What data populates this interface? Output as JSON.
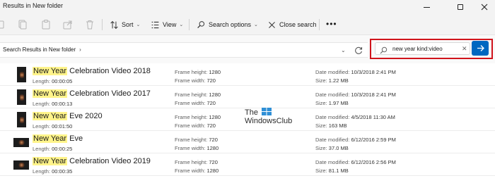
{
  "window": {
    "title": "Results in New folder"
  },
  "toolbar": {
    "sort_label": "Sort",
    "view_label": "View",
    "search_options_label": "Search options",
    "close_search_label": "Close search"
  },
  "address": {
    "crumb": "Search Results in New folder"
  },
  "search": {
    "query": "new year kind:video",
    "accent_color": "#0067c0",
    "highlight_color": "#d0131b"
  },
  "results": [
    {
      "highlight": "New Year",
      "rest": " Celebration Video 2018",
      "length_label": "Length:",
      "length": "00:00:05",
      "frame_height_label": "Frame height:",
      "frame_height": "1280",
      "frame_width_label": "Frame width:",
      "frame_width": "720",
      "date_modified_label": "Date modified:",
      "date_modified": "10/3/2018 2:41 PM",
      "size_label": "Size:",
      "size": "1.22 MB",
      "thumb": "portrait"
    },
    {
      "highlight": "New Year",
      "rest": " Celebration Video 2017",
      "length_label": "Length:",
      "length": "00:00:13",
      "frame_height_label": "Frame height:",
      "frame_height": "1280",
      "frame_width_label": "Frame width:",
      "frame_width": "720",
      "date_modified_label": "Date modified:",
      "date_modified": "10/3/2018 2:41 PM",
      "size_label": "Size:",
      "size": "1.97 MB",
      "thumb": "portrait"
    },
    {
      "highlight": "New Year",
      "rest": " Eve 2020",
      "length_label": "Length:",
      "length": "00:01:50",
      "frame_height_label": "Frame height:",
      "frame_height": "1280",
      "frame_width_label": "Frame width:",
      "frame_width": "720",
      "date_modified_label": "Date modified:",
      "date_modified": "4/5/2018 11:30 AM",
      "size_label": "Size:",
      "size": "163 MB",
      "thumb": "portrait"
    },
    {
      "highlight": "New Year",
      "rest": " Eve",
      "length_label": "Length:",
      "length": "00:00:25",
      "frame_height_label": "Frame height:",
      "frame_height": "720",
      "frame_width_label": "Frame width:",
      "frame_width": "1280",
      "date_modified_label": "Date modified:",
      "date_modified": "6/12/2016 2:59 PM",
      "size_label": "Size:",
      "size": "37.0 MB",
      "thumb": "landscape"
    },
    {
      "highlight": "New Year",
      "rest": " Celebration Video 2019",
      "length_label": "Length:",
      "length": "00:00:35",
      "frame_height_label": "Frame height:",
      "frame_height": "720",
      "frame_width_label": "Frame width:",
      "frame_width": "1280",
      "date_modified_label": "Date modified:",
      "date_modified": "6/12/2016 2:56 PM",
      "size_label": "Size:",
      "size": "81.1 MB",
      "thumb": "landscape"
    }
  ],
  "watermark": {
    "line1": "The",
    "line2": "WindowsClub"
  },
  "icons": {
    "copy": "copy-icon",
    "paste": "paste-icon",
    "rename": "rename-icon",
    "share": "share-icon",
    "delete": "delete-icon",
    "sort": "sort-icon",
    "view": "view-icon",
    "search_options": "search-options-icon",
    "close": "close-icon",
    "more": "more-icon",
    "refresh": "refresh-icon",
    "search": "search-icon",
    "arrow": "arrow-right-icon"
  }
}
